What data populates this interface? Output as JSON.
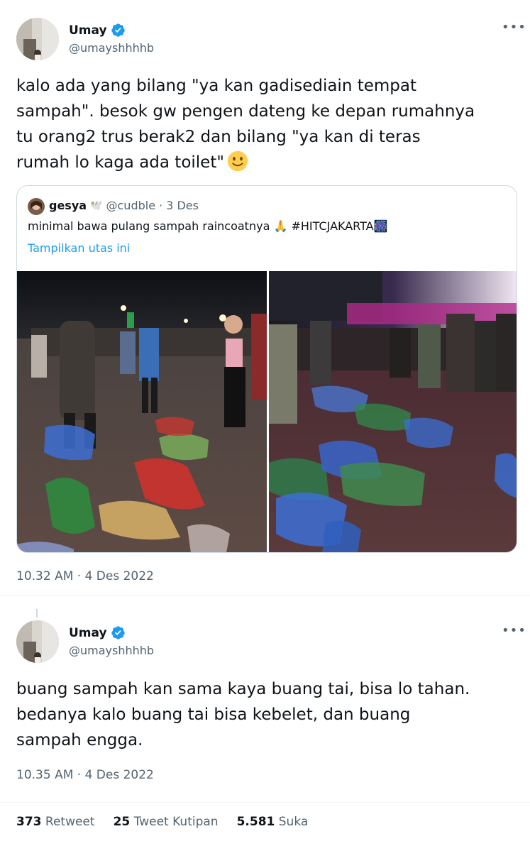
{
  "tweet1": {
    "author_name": "Umay",
    "author_handle": "@umayshhhhb",
    "more_icon": "more-horizontal-icon",
    "text": "kalo ada yang bilang \"ya kan gadisediain tempat\nsampah\". besok gw pengen dateng ke depan rumahnya\ntu orang2 trus berak2 dan bilang \"ya kan di teras\nrumah lo kaga ada toilet\"",
    "emoji": "slightly-smiling-face-emoji",
    "timestamp": "10.32 AM · 4 Des 2022",
    "quote": {
      "author_name": "gesya",
      "author_emoji": "🕊️",
      "author_handle": "@cudble",
      "date": "· 3 Des",
      "text": "minimal bawa pulang sampah raincoatnya 🙏 #HITCJAKARTA🎆",
      "show_thread_label": "Tampilkan utas ini"
    }
  },
  "tweet2": {
    "author_name": "Umay",
    "author_handle": "@umayshhhhb",
    "more_icon": "more-horizontal-icon",
    "text": "buang sampah kan sama kaya buang tai, bisa lo tahan.\nbedanya kalo buang tai bisa kebelet, dan buang\nsampah engga.",
    "timestamp": "10.35 AM · 4 Des 2022"
  },
  "stats": {
    "retweets_count": "373",
    "retweets_label": "Retweet",
    "quotes_count": "25",
    "quotes_label": "Tweet Kutipan",
    "likes_count": "5.581",
    "likes_label": "Suka"
  },
  "colors": {
    "verified_blue": "#1d9bf0",
    "secondary_text": "#536471",
    "link_blue": "#1d9bf0",
    "border": "#cfd9de"
  }
}
